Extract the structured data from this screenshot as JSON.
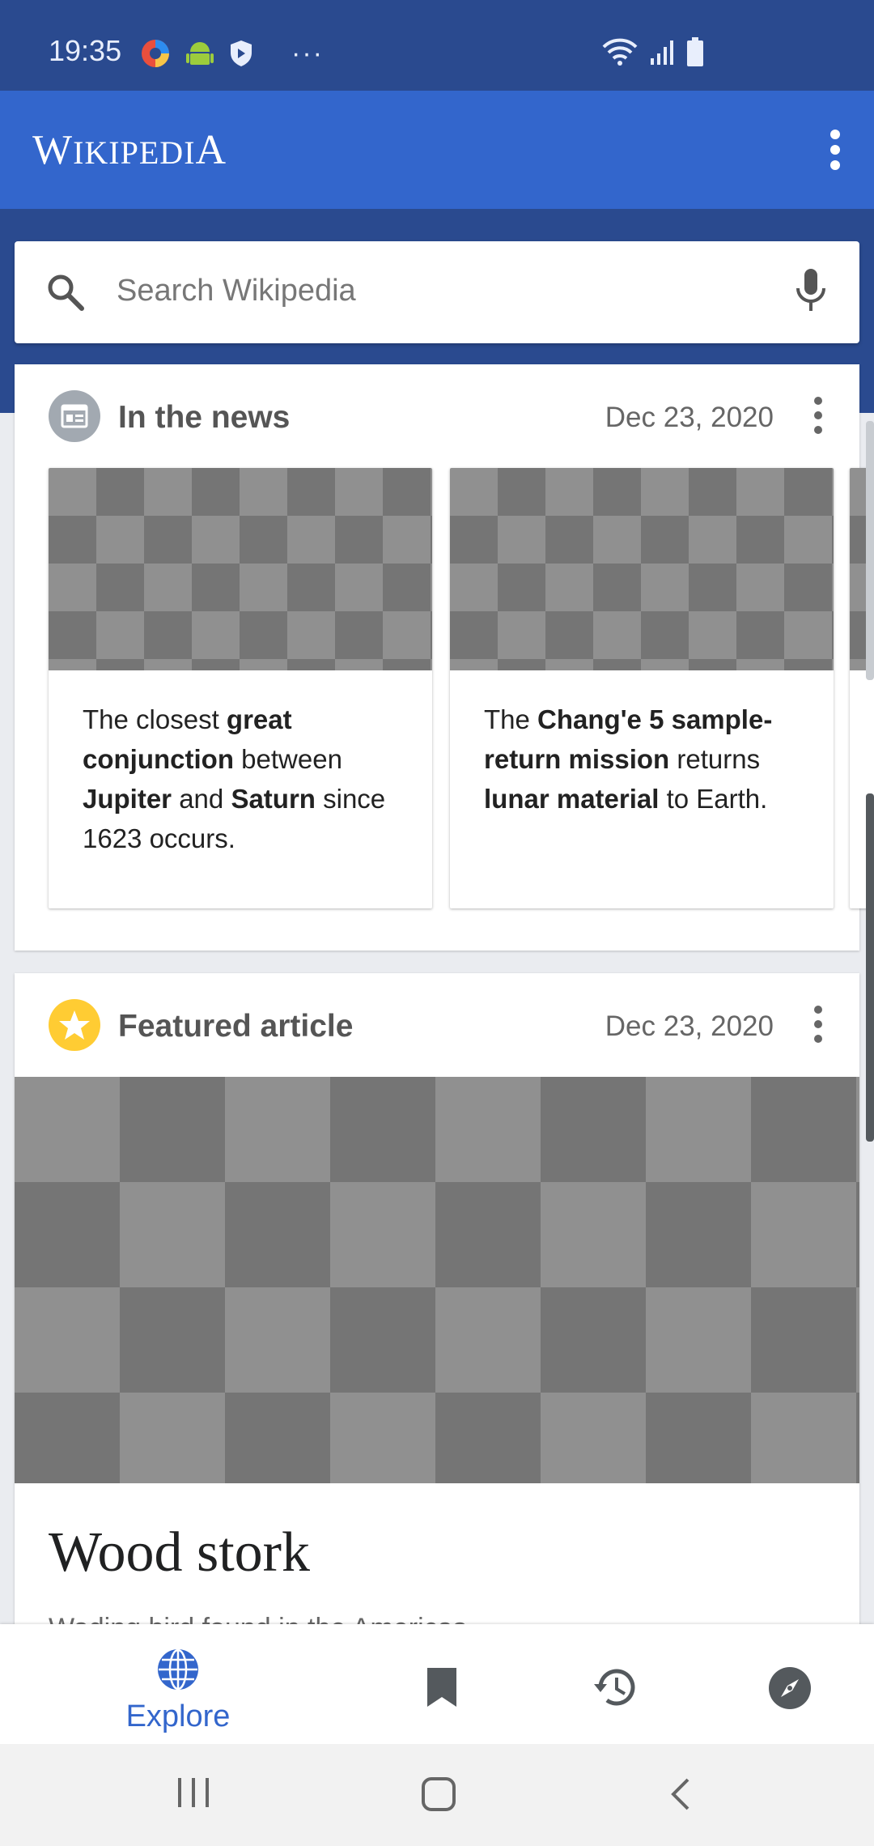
{
  "status_bar": {
    "time": "19:35",
    "more": "···",
    "icons": [
      "browser-icon",
      "android-icon",
      "shield-icon",
      "wifi-icon",
      "signal-icon",
      "battery-icon"
    ]
  },
  "app_bar": {
    "brand_first": "W",
    "brand_mid": "IKIPEDI",
    "brand_last": "A"
  },
  "search": {
    "placeholder": "Search Wikipedia"
  },
  "news_card": {
    "title": "In the news",
    "date": "Dec 23, 2020",
    "items": [
      {
        "parts": [
          "The closest ",
          "great conjunction",
          " between ",
          "Jupiter",
          " and ",
          "Saturn",
          " since 1623 occurs."
        ]
      },
      {
        "parts": [
          "The ",
          "Chang'e 5 sample-return mission",
          " returns ",
          "lunar material",
          " to Earth."
        ]
      }
    ]
  },
  "featured_card": {
    "title": "Featured article",
    "date": "Dec 23, 2020",
    "article_title": "Wood stork",
    "article_desc": "Wading bird found in the Americas"
  },
  "bottom_nav": {
    "explore_label": "Explore",
    "active_color": "#3366cc"
  }
}
